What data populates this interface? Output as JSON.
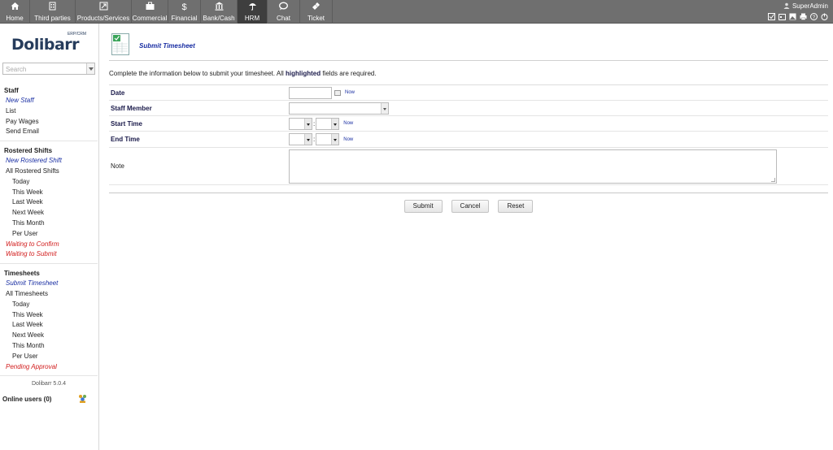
{
  "topnav": [
    {
      "label": "Home",
      "icon": "home-icon",
      "active": false
    },
    {
      "label": "Third parties",
      "icon": "building-icon",
      "active": false
    },
    {
      "label": "Products/Services",
      "icon": "cube-icon",
      "active": false
    },
    {
      "label": "Commercial",
      "icon": "briefcase-icon",
      "active": false
    },
    {
      "label": "Financial",
      "icon": "dollar-icon",
      "active": false
    },
    {
      "label": "Bank/Cash",
      "icon": "bank-icon",
      "active": false
    },
    {
      "label": "HRM",
      "icon": "umbrella-icon",
      "active": true
    },
    {
      "label": "Chat",
      "icon": "chat-icon",
      "active": false
    },
    {
      "label": "Ticket",
      "icon": "ticket-icon",
      "active": false
    }
  ],
  "user": {
    "name": "SuperAdmin"
  },
  "sidebar": {
    "logo": "Dolibarr",
    "logo_sub": "ERP/CRM",
    "search_placeholder": "Search",
    "sections": [
      {
        "heading": "Staff",
        "items": [
          {
            "label": "New Staff",
            "style": "ital",
            "indent": false
          },
          {
            "label": "List",
            "style": "",
            "indent": false
          },
          {
            "label": "Pay Wages",
            "style": "",
            "indent": false
          },
          {
            "label": "Send Email",
            "style": "",
            "indent": false
          }
        ]
      },
      {
        "heading": "Rostered Shifts",
        "items": [
          {
            "label": "New Rostered Shift",
            "style": "ital",
            "indent": false
          },
          {
            "label": "All Rostered Shifts",
            "style": "",
            "indent": false
          },
          {
            "label": "Today",
            "style": "",
            "indent": true
          },
          {
            "label": "This Week",
            "style": "",
            "indent": true
          },
          {
            "label": "Last Week",
            "style": "",
            "indent": true
          },
          {
            "label": "Next Week",
            "style": "",
            "indent": true
          },
          {
            "label": "This Month",
            "style": "",
            "indent": true
          },
          {
            "label": "Per User",
            "style": "",
            "indent": true
          },
          {
            "label": "Waiting to Confirm",
            "style": "red",
            "indent": false
          },
          {
            "label": "Waiting to Submit",
            "style": "red",
            "indent": false
          }
        ]
      },
      {
        "heading": "Timesheets",
        "items": [
          {
            "label": "Submit Timesheet",
            "style": "ital",
            "indent": false
          },
          {
            "label": "All Timesheets",
            "style": "",
            "indent": false
          },
          {
            "label": "Today",
            "style": "",
            "indent": true
          },
          {
            "label": "This Week",
            "style": "",
            "indent": true
          },
          {
            "label": "Last Week",
            "style": "",
            "indent": true
          },
          {
            "label": "Next Week",
            "style": "",
            "indent": true
          },
          {
            "label": "This Month",
            "style": "",
            "indent": true
          },
          {
            "label": "Per User",
            "style": "",
            "indent": true
          },
          {
            "label": "Pending Approval",
            "style": "red",
            "indent": false
          }
        ]
      }
    ],
    "version": "Dolibarr 5.0.4",
    "online_users": "Online users (0)"
  },
  "page": {
    "title": "Submit Timesheet",
    "intro_before": "Complete the information below to submit your timesheet. All ",
    "intro_bold": "highlighted",
    "intro_after": " fields are required."
  },
  "form": {
    "date_label": "Date",
    "staff_label": "Staff Member",
    "start_label": "Start Time",
    "end_label": "End Time",
    "note_label": "Note",
    "now_label": "Now",
    "colon": ":"
  },
  "buttons": {
    "submit": "Submit",
    "cancel": "Cancel",
    "reset": "Reset"
  },
  "colors": {
    "topbar": "#6f6f6f",
    "active_tab": "#3e3e3e",
    "link_blue": "#1a2fa3",
    "link_red": "#d11a1a"
  }
}
